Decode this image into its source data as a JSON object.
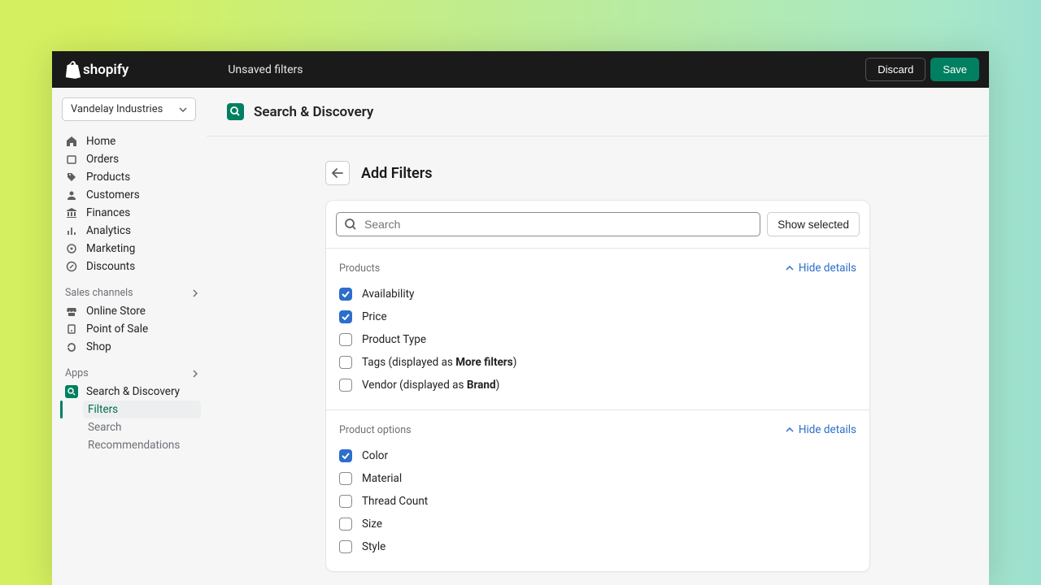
{
  "topbar": {
    "brand": "shopify",
    "title": "Unsaved filters",
    "discard": "Discard",
    "save": "Save"
  },
  "sidebar": {
    "store": "Vandelay Industries",
    "nav": [
      "Home",
      "Orders",
      "Products",
      "Customers",
      "Finances",
      "Analytics",
      "Marketing",
      "Discounts"
    ],
    "sales_header": "Sales channels",
    "sales": [
      "Online Store",
      "Point of Sale",
      "Shop"
    ],
    "apps_header": "Apps",
    "app": "Search & Discovery",
    "sub": [
      "Filters",
      "Search",
      "Recommendations"
    ]
  },
  "main": {
    "app_title": "Search & Discovery",
    "page_title": "Add Filters",
    "search_placeholder": "Search",
    "show_selected": "Show selected",
    "hide_details": "Hide details",
    "sections": {
      "products": {
        "title": "Products",
        "items": [
          {
            "label": "Availability",
            "checked": true
          },
          {
            "label": "Price",
            "checked": true
          },
          {
            "label": "Product Type",
            "checked": false
          },
          {
            "prefix": "Tags (displayed as ",
            "bold": "More filters",
            "suffix": ")",
            "checked": false
          },
          {
            "prefix": "Vendor (displayed as ",
            "bold": "Brand",
            "suffix": ")",
            "checked": false
          }
        ]
      },
      "product_options": {
        "title": "Product options",
        "items": [
          {
            "label": "Color",
            "checked": true
          },
          {
            "label": "Material",
            "checked": false
          },
          {
            "label": "Thread Count",
            "checked": false
          },
          {
            "label": "Size",
            "checked": false
          },
          {
            "label": "Style",
            "checked": false
          }
        ]
      }
    }
  }
}
